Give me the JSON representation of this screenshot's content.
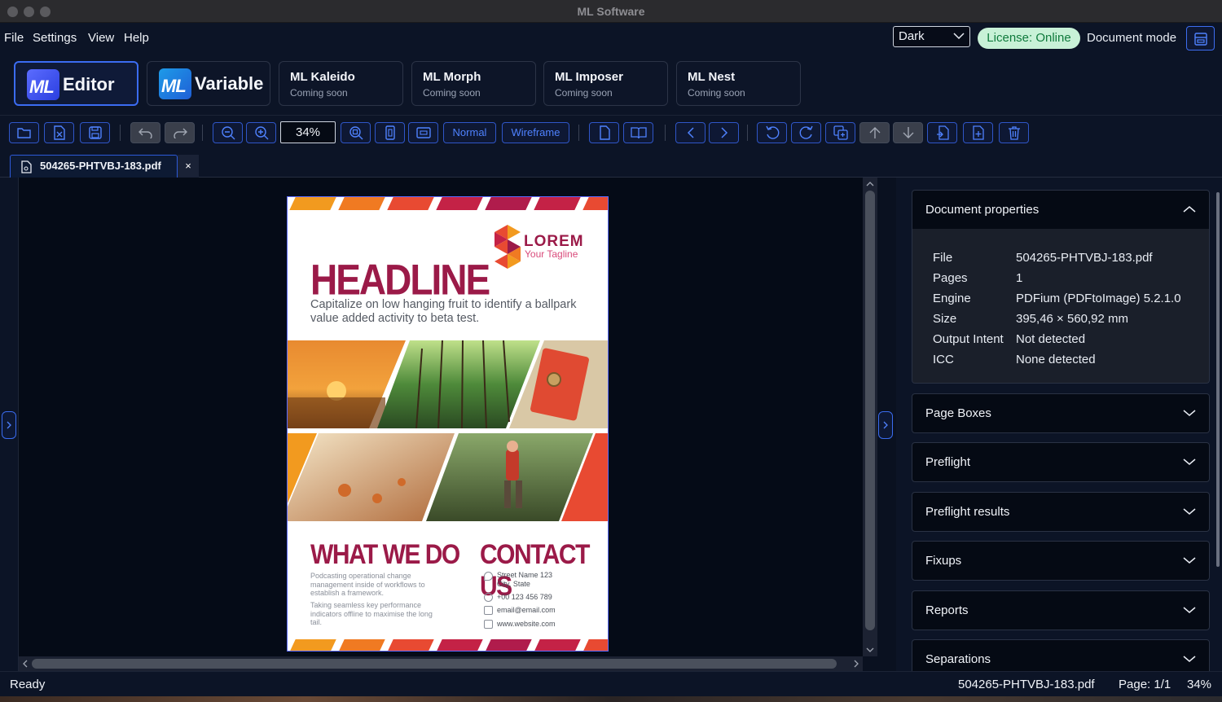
{
  "window": {
    "title": "ML Software"
  },
  "menu": {
    "items": [
      "File",
      "Settings",
      "View",
      "Help"
    ]
  },
  "header": {
    "theme": "Dark",
    "license": "License: Online",
    "mode_label": "Document mode"
  },
  "apps": {
    "editor": {
      "logo": "ML",
      "label": "Editor"
    },
    "variable": {
      "logo": "ML",
      "label": "Variable"
    },
    "kaleido": {
      "name": "ML Kaleido",
      "status": "Coming soon"
    },
    "morph": {
      "name": "ML Morph",
      "status": "Coming soon"
    },
    "imposer": {
      "name": "ML Imposer",
      "status": "Coming soon"
    },
    "nest": {
      "name": "ML Nest",
      "status": "Coming soon"
    }
  },
  "toolbar": {
    "zoom": "34%",
    "view_normal": "Normal",
    "view_wireframe": "Wireframe"
  },
  "tab": {
    "filename": "504265-PHTVBJ-183.pdf",
    "close": "×"
  },
  "flyer": {
    "logo_word": "LOREM",
    "logo_tagline": "Your Tagline",
    "headline": "HEADLINE",
    "subheadline": "Capitalize on low hanging fruit to identify a ballpark value added activity to beta test.",
    "what_title": "WHAT WE DO",
    "what_p1": "Podcasting operational change management inside of workflows to establish a framework.",
    "what_p2": "Taking seamless key performance indicators offline to maximise the long tail.",
    "contact_title": "CONTACT US",
    "contact_address_1": "Street Name 123",
    "contact_address_2": "City, State",
    "contact_phone": "+00 123 456 789",
    "contact_email": "email@email.com",
    "contact_web": "www.website.com"
  },
  "panel": {
    "document_properties": "Document properties",
    "props": {
      "file_key": "File",
      "file_val": "504265-PHTVBJ-183.pdf",
      "pages_key": "Pages",
      "pages_val": "1",
      "engine_key": "Engine",
      "engine_val": "PDFium (PDFtoImage) 5.2.1.0",
      "size_key": "Size",
      "size_val": "395,46 × 560,92 mm",
      "intent_key": "Output Intent",
      "intent_val": "Not detected",
      "icc_key": "ICC",
      "icc_val": "None detected"
    },
    "sections": [
      "Page Boxes",
      "Preflight",
      "Preflight results",
      "Fixups",
      "Reports",
      "Separations"
    ]
  },
  "status": {
    "state": "Ready",
    "file": "504265-PHTVBJ-183.pdf",
    "page": "Page: 1/1",
    "zoom": "34%"
  },
  "colors": {
    "accent": "#3b6cf2",
    "brand_magenta": "#9b1a48",
    "license_bg": "#c8f1d7",
    "license_fg": "#0f7a3c",
    "stripe_orange": "#f29a1f",
    "stripe_red": "#e84a32",
    "stripe_crimson": "#c42246"
  }
}
